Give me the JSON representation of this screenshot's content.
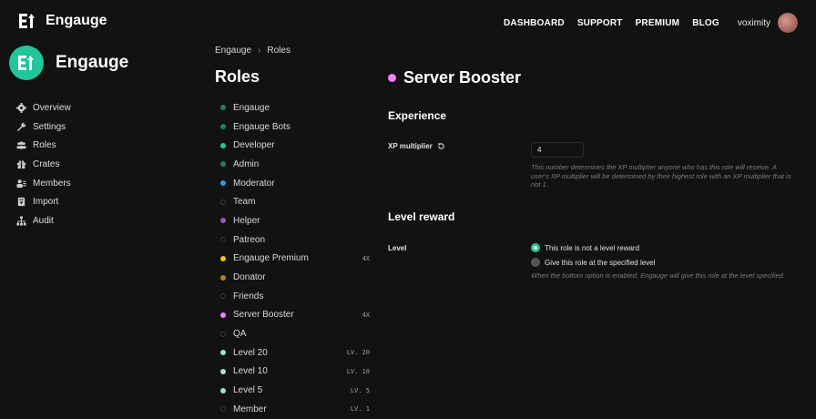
{
  "app": {
    "name": "Engauge"
  },
  "topnav": {
    "items": [
      "DASHBOARD",
      "SUPPORT",
      "PREMIUM",
      "BLOG"
    ],
    "username": "voximity"
  },
  "sidebar": {
    "title": "Engauge",
    "items": [
      {
        "label": "Overview",
        "icon": "gear-icon"
      },
      {
        "label": "Settings",
        "icon": "wrench-icon"
      },
      {
        "label": "Roles",
        "icon": "users-icon"
      },
      {
        "label": "Crates",
        "icon": "gift-icon"
      },
      {
        "label": "Members",
        "icon": "members-icon"
      },
      {
        "label": "Import",
        "icon": "import-icon"
      },
      {
        "label": "Audit",
        "icon": "audit-icon"
      }
    ]
  },
  "breadcrumb": {
    "first": "Engauge",
    "second": "Roles"
  },
  "roles": {
    "heading": "Roles",
    "items": [
      {
        "name": "Engauge",
        "color": "#1a7f64",
        "badge": ""
      },
      {
        "name": "Engauge Bots",
        "color": "#1a7f64",
        "badge": ""
      },
      {
        "name": "Developer",
        "color": "#21c79a",
        "badge": ""
      },
      {
        "name": "Admin",
        "color": "#1a7f64",
        "badge": ""
      },
      {
        "name": "Moderator",
        "color": "#3498db",
        "badge": ""
      },
      {
        "name": "Team",
        "color": "",
        "badge": ""
      },
      {
        "name": "Helper",
        "color": "#9b59b6",
        "badge": ""
      },
      {
        "name": "Patreon",
        "color": "",
        "badge": ""
      },
      {
        "name": "Engauge Premium",
        "color": "#f1c40f",
        "badge": "4X"
      },
      {
        "name": "Donator",
        "color": "#c27c0e",
        "badge": ""
      },
      {
        "name": "Friends",
        "color": "",
        "badge": ""
      },
      {
        "name": "Server Booster",
        "color": "#f47fff",
        "badge": "4X"
      },
      {
        "name": "QA",
        "color": "",
        "badge": ""
      },
      {
        "name": "Level 20",
        "color": "#a3e4c9",
        "badge": "LV. 20"
      },
      {
        "name": "Level 10",
        "color": "#a3e4c9",
        "badge": "LV. 10"
      },
      {
        "name": "Level 5",
        "color": "#a3e4c9",
        "badge": "LV. 5"
      },
      {
        "name": "Member",
        "color": "",
        "badge": "LV. 1"
      }
    ]
  },
  "detail": {
    "title": "Server Booster",
    "title_color": "#f47fff",
    "experience": {
      "heading": "Experience",
      "xp_label": "XP multiplier",
      "xp_value": "4",
      "xp_help": "This number determines the XP multiplier anyone who has this role will receive. A user's XP multiplier will be determined by their highest role with an XP multiplier that is not 1."
    },
    "level_reward": {
      "heading": "Level reward",
      "label": "Level",
      "option_1": "This role is not a level reward",
      "option_2": "Give this role at the specified level",
      "help": "When the bottom option is enabled, Engauge will give this role at the level specified."
    }
  },
  "colors": {
    "accent": "#21c79a",
    "background": "#121212"
  }
}
